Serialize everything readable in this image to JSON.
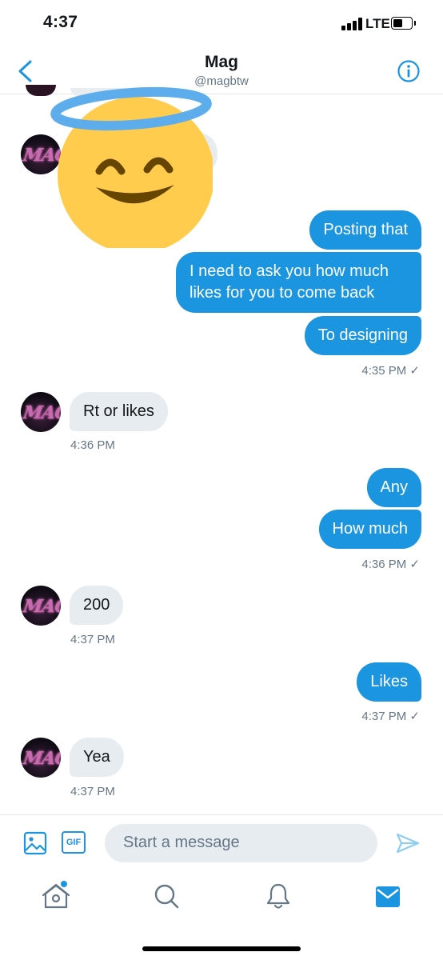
{
  "status_bar": {
    "time": "4:37",
    "network": "LTE"
  },
  "header": {
    "name": "Mag",
    "handle": "@magbtw"
  },
  "messages": [
    {
      "from": "me",
      "text": "Posting that"
    },
    {
      "from": "me",
      "text": "I need to ask you how much likes for you to come back"
    },
    {
      "from": "me",
      "text": "To designing"
    },
    {
      "from": "me",
      "meta": "4:35 PM ✓"
    },
    {
      "from": "them",
      "text": "Rt or likes",
      "meta": "4:36 PM"
    },
    {
      "from": "me",
      "text": "Any"
    },
    {
      "from": "me",
      "text": "How much"
    },
    {
      "from": "me",
      "meta": "4:36 PM ✓"
    },
    {
      "from": "them",
      "text": "200",
      "meta": "4:37 PM"
    },
    {
      "from": "me",
      "text": "Likes",
      "meta": "4:37 PM ✓"
    },
    {
      "from": "them",
      "text": "Yea",
      "meta": "4:37 PM"
    }
  ],
  "composer": {
    "placeholder": "Start a message",
    "gif_label": "GIF"
  },
  "colors": {
    "accent": "#1b95e0",
    "incoming_bubble": "#e6ecf0",
    "meta_text": "#657786"
  },
  "icons": [
    "back-arrow-icon",
    "info-icon",
    "image-icon",
    "gif-icon",
    "send-icon",
    "home-icon",
    "search-icon",
    "bell-icon",
    "mail-icon",
    "halo-smiling-face-emoji"
  ]
}
